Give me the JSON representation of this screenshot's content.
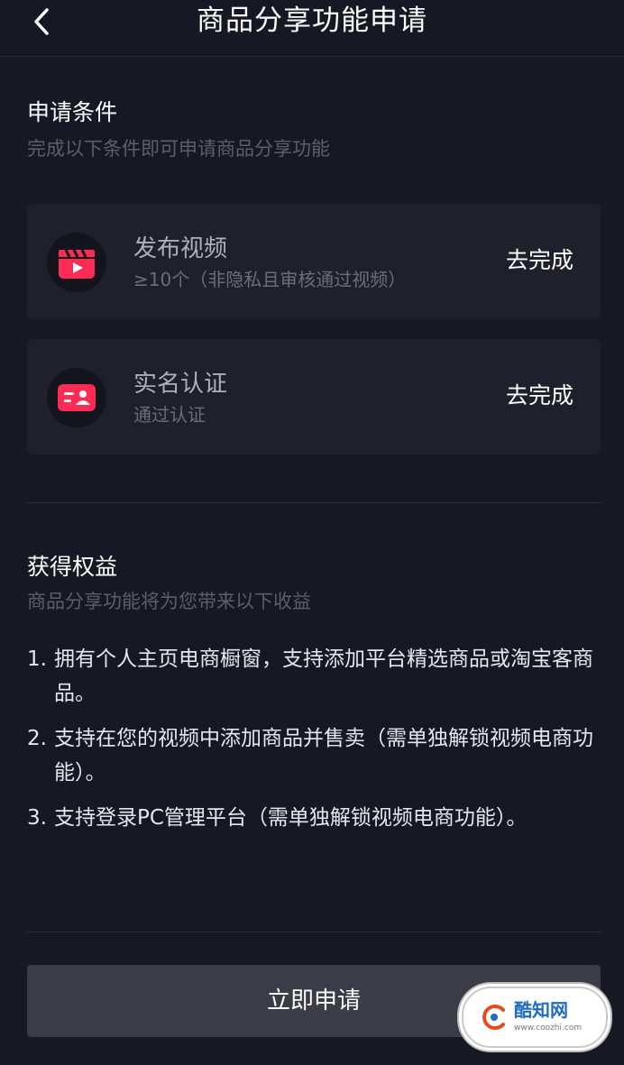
{
  "header": {
    "title": "商品分享功能申请",
    "back_icon": "chevron-left-icon"
  },
  "conditions": {
    "title": "申请条件",
    "subtitle": "完成以下条件即可申请商品分享功能",
    "items": [
      {
        "icon": "video-clapper-icon",
        "title": "发布视频",
        "subtitle": "≥10个（非隐私且审核通过视频）",
        "action": "去完成"
      },
      {
        "icon": "id-card-icon",
        "title": "实名认证",
        "subtitle": "通过认证",
        "action": "去完成"
      }
    ]
  },
  "benefits": {
    "title": "获得权益",
    "subtitle": "商品分享功能将为您带来以下收益",
    "items": [
      {
        "num": "1.",
        "text": "拥有个人主页电商橱窗，支持添加平台精选商品或淘宝客商品。"
      },
      {
        "num": "2.",
        "text": "支持在您的视频中添加商品并售卖（需单独解锁视频电商功能）。"
      },
      {
        "num": "3.",
        "text": "支持登录PC管理平台（需单独解锁视频电商功能）。"
      }
    ]
  },
  "apply_button": {
    "label": "立即申请"
  },
  "watermark": {
    "name": "酷知网",
    "url": "www.coozhi.com"
  },
  "colors": {
    "background": "#161823",
    "card": "#1e202b",
    "icon_accent": "#fe2c55",
    "button": "#3a3c47"
  }
}
